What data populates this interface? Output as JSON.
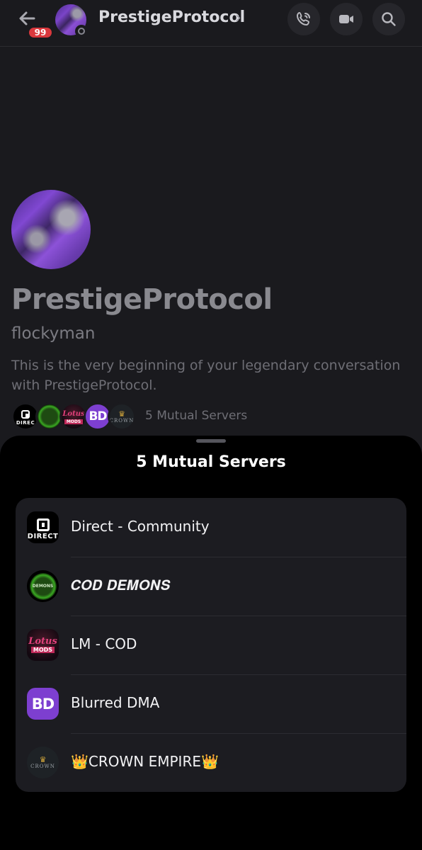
{
  "header": {
    "title": "PrestigeProtocol",
    "unread_badge": "99",
    "icons": [
      "back-arrow-icon",
      "phone-icon",
      "video-camera-icon",
      "search-icon"
    ]
  },
  "profile": {
    "display_name": "PrestigeProtocol",
    "username": "flockyman",
    "intro": "This is the very beginning of your legendary conversation with PrestigeProtocol.",
    "mutual_servers_label": "5 Mutual Servers"
  },
  "sheet": {
    "title": "5 Mutual Servers",
    "servers": [
      {
        "name": "Direct - Community",
        "icon_text": "DIRECT"
      },
      {
        "name": "𝑪𝑶𝑫 𝑫𝑬𝑴𝑶𝑵𝑺",
        "icon_text": "DEMONS"
      },
      {
        "name": "LM - COD",
        "icon_text": "Lotus",
        "icon_sub": "MODS"
      },
      {
        "name": "Blurred DMA",
        "icon_text": "BD"
      },
      {
        "name": "👑CROWN EMPIRE👑",
        "icon_text": "CROWN"
      }
    ]
  },
  "colors": {
    "background": "#1a1a1e",
    "sheet": "#000000",
    "list_bg": "#1c1c21",
    "badge": "#d9383d",
    "bd_purple": "#7d3fd0"
  }
}
